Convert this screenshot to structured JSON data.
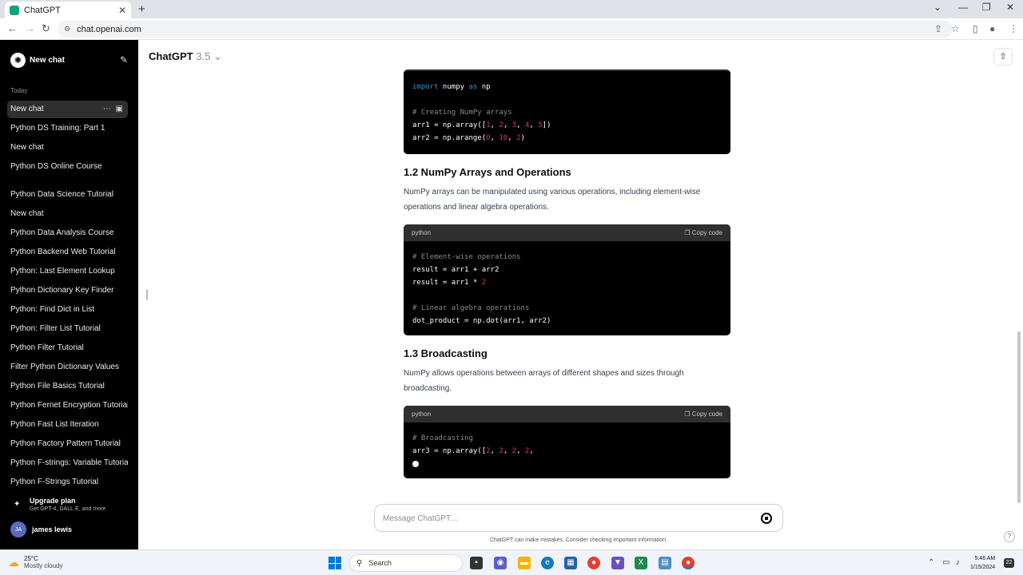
{
  "browser": {
    "tab_title": "ChatGPT",
    "url": "chat.openai.com"
  },
  "sidebar": {
    "new_chat_label": "New chat",
    "section_today": "Today",
    "items": [
      {
        "label": "New chat"
      },
      {
        "label": "Python DS Training: Part 1"
      },
      {
        "label": "New chat"
      },
      {
        "label": "Python DS Online Course"
      },
      {
        "label": "Python Data Science Tutorial"
      },
      {
        "label": "New chat"
      },
      {
        "label": "Python Data Analysis Course"
      },
      {
        "label": "Python Backend Web Tutorial"
      },
      {
        "label": "Python: Last Element Lookup"
      },
      {
        "label": "Python Dictionary Key Finder"
      },
      {
        "label": "Python: Find Dict in List"
      },
      {
        "label": "Python: Filter List Tutorial"
      },
      {
        "label": "Python Filter Tutorial"
      },
      {
        "label": "Filter Python Dictionary Values"
      },
      {
        "label": "Python File Basics Tutorial"
      },
      {
        "label": "Python Fernet Encryption Tutorial"
      },
      {
        "label": "Python Fast List Iteration"
      },
      {
        "label": "Python Factory Pattern Tutorial"
      },
      {
        "label": "Python F-strings: Variable Tutorial"
      },
      {
        "label": "Python F-Strings Tutorial"
      }
    ],
    "upgrade_title": "Upgrade plan",
    "upgrade_subtitle": "Get GPT-4, DALL·E, and more",
    "user_initials": "JA",
    "user_name": "james lewis"
  },
  "header": {
    "model_name": "ChatGPT",
    "model_version": "3.5"
  },
  "content": {
    "code1": {
      "lines": [
        {
          "parts": [
            {
              "t": "import",
              "c": "kw"
            },
            {
              "t": " numpy ",
              "c": ""
            },
            {
              "t": "as",
              "c": "kw"
            },
            {
              "t": " np",
              "c": ""
            }
          ]
        },
        {
          "parts": [
            {
              "t": "",
              "c": ""
            }
          ]
        },
        {
          "parts": [
            {
              "t": "# Creating NumPy arrays",
              "c": "cm"
            }
          ]
        },
        {
          "parts": [
            {
              "t": "arr1 = np.array([",
              "c": ""
            },
            {
              "t": "1",
              "c": "nu"
            },
            {
              "t": ", ",
              "c": ""
            },
            {
              "t": "2",
              "c": "nu"
            },
            {
              "t": ", ",
              "c": ""
            },
            {
              "t": "3",
              "c": "nu"
            },
            {
              "t": ", ",
              "c": ""
            },
            {
              "t": "4",
              "c": "nu"
            },
            {
              "t": ", ",
              "c": ""
            },
            {
              "t": "5",
              "c": "nu"
            },
            {
              "t": "])",
              "c": ""
            }
          ]
        },
        {
          "parts": [
            {
              "t": "arr2 = np.arange(",
              "c": ""
            },
            {
              "t": "0",
              "c": "nu"
            },
            {
              "t": ", ",
              "c": ""
            },
            {
              "t": "10",
              "c": "nu"
            },
            {
              "t": ", ",
              "c": ""
            },
            {
              "t": "2",
              "c": "nu"
            },
            {
              "t": ")",
              "c": ""
            }
          ]
        }
      ]
    },
    "section2_heading": "1.2 NumPy Arrays and Operations",
    "section2_text": "NumPy arrays can be manipulated using various operations, including element-wise operations and linear algebra operations.",
    "code2": {
      "language": "python",
      "copy_label": "Copy code",
      "lines": [
        {
          "parts": [
            {
              "t": "# Element-wise operations",
              "c": "cm"
            }
          ]
        },
        {
          "parts": [
            {
              "t": "result = arr1 + arr2",
              "c": ""
            }
          ]
        },
        {
          "parts": [
            {
              "t": "result = arr1 * ",
              "c": ""
            },
            {
              "t": "2",
              "c": "nu"
            }
          ]
        },
        {
          "parts": [
            {
              "t": "",
              "c": ""
            }
          ]
        },
        {
          "parts": [
            {
              "t": "# Linear algebra operations",
              "c": "cm"
            }
          ]
        },
        {
          "parts": [
            {
              "t": "dot_product = np.dot(arr1, arr2)",
              "c": ""
            }
          ]
        }
      ]
    },
    "section3_heading": "1.3 Broadcasting",
    "section3_text": "NumPy allows operations between arrays of different shapes and sizes through broadcasting.",
    "code3": {
      "language": "python",
      "copy_label": "Copy code",
      "lines": [
        {
          "parts": [
            {
              "t": "# Broadcasting",
              "c": "cm"
            }
          ]
        },
        {
          "parts": [
            {
              "t": "arr3 = np.array([",
              "c": ""
            },
            {
              "t": "2",
              "c": "nu"
            },
            {
              "t": ", ",
              "c": ""
            },
            {
              "t": "2",
              "c": "nu"
            },
            {
              "t": ", ",
              "c": ""
            },
            {
              "t": "2",
              "c": "nu"
            },
            {
              "t": ", ",
              "c": ""
            },
            {
              "t": "2",
              "c": "nu"
            },
            {
              "t": ",",
              "c": ""
            }
          ]
        }
      ]
    }
  },
  "composer": {
    "placeholder": "Message ChatGPT…",
    "disclaimer": "ChatGPT can make mistakes. Consider checking important information."
  },
  "taskbar": {
    "temperature": "25°C",
    "weather": "Mostly cloudy",
    "search_label": "Search",
    "time": "5:46 AM",
    "date": "1/15/2024",
    "notification_count": "22"
  },
  "colors": {
    "sidebar_bg": "#000000",
    "code_keyword": "#2e95d3",
    "code_number": "#df3079",
    "code_comment": "#8a8a8a"
  }
}
